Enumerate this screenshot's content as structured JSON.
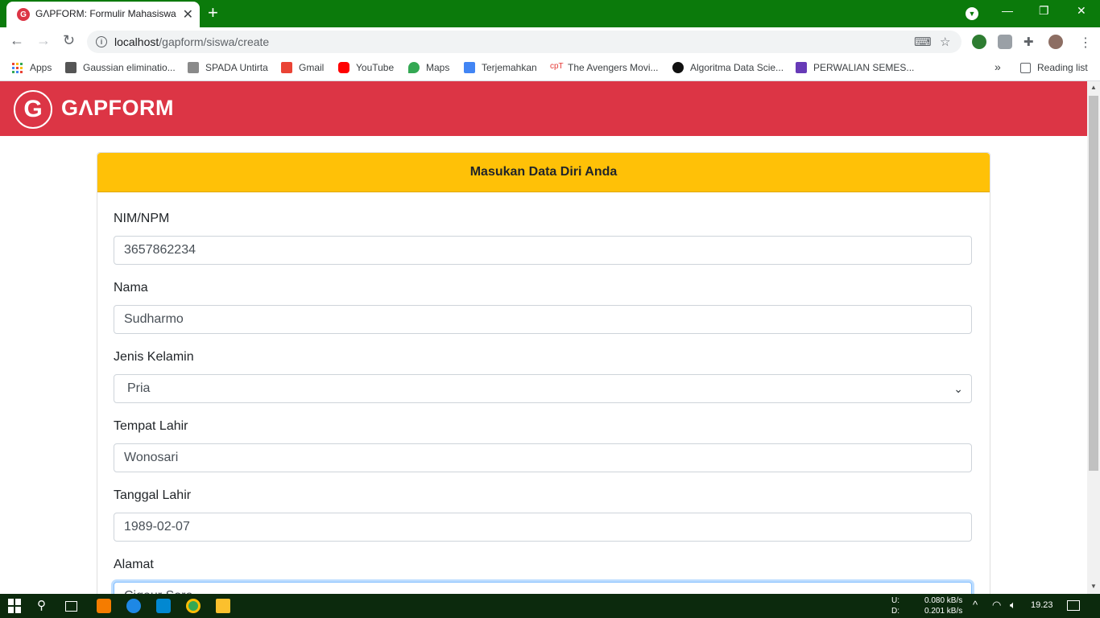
{
  "browser": {
    "tab_title": "GΛPFORM: Formulir Mahasiswa",
    "url_host": "localhost",
    "url_path": "/gapform/siswa/create",
    "bookmarks": [
      "Apps",
      "Gaussian eliminatio...",
      "SPADA Untirta",
      "Gmail",
      "YouTube",
      "Maps",
      "Terjemahkan",
      "The Avengers Movi...",
      "Algoritma Data Scie...",
      "PERWALIAN SEMES..."
    ],
    "reading_list": "Reading list",
    "overflow": "»"
  },
  "app": {
    "brand": "GΛPFORM",
    "logo_letter": "G"
  },
  "form": {
    "header": "Masukan Data Diri Anda",
    "fields": [
      {
        "label": "NIM/NPM",
        "value": "3657862234",
        "type": "text"
      },
      {
        "label": "Nama",
        "value": "Sudharmo",
        "type": "text"
      },
      {
        "label": "Jenis Kelamin",
        "value": "Pria",
        "type": "select"
      },
      {
        "label": "Tempat Lahir",
        "value": "Wonosari",
        "type": "text"
      },
      {
        "label": "Tanggal Lahir",
        "value": "1989-02-07",
        "type": "text"
      },
      {
        "label": "Alamat",
        "value": "Cigeur Sore",
        "type": "textarea"
      }
    ]
  },
  "taskbar": {
    "net_up_label": "U:",
    "net_down_label": "D:",
    "net_up": "0.080 kB/s",
    "net_down": "0.201 kB/s",
    "time": "19.23"
  },
  "colors": {
    "chrome_frame": "#0b7a0b",
    "navbar": "#dc3545",
    "card_header": "#ffc107",
    "taskbar": "#0c2a0d"
  }
}
